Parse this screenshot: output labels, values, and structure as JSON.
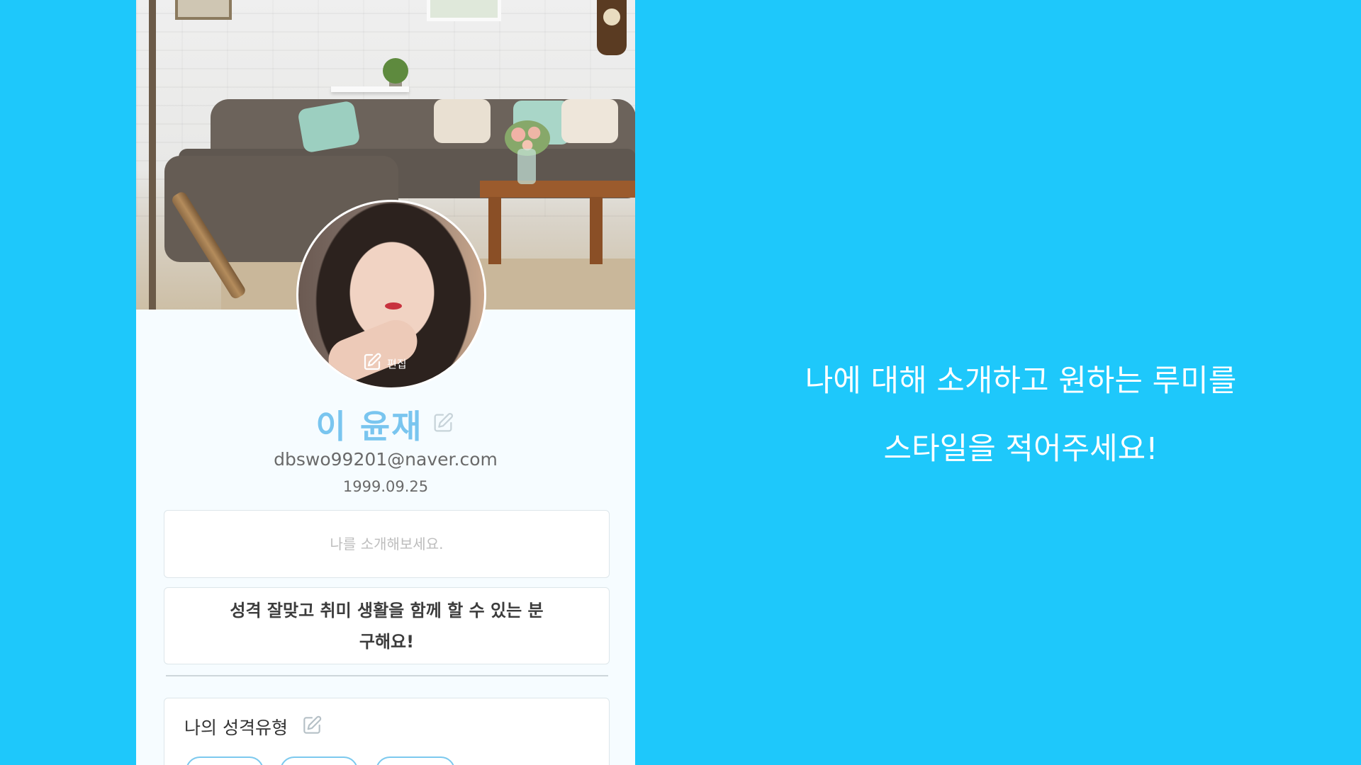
{
  "profile": {
    "name": "이 윤재",
    "email": "dbswo99201@naver.com",
    "birthdate": "1999.09.25",
    "avatar_edit_label": "편집",
    "intro_placeholder": "나를 소개해보세요.",
    "wish_text_line1": "성격 잘맞고 취미 생활을 함께 할 수 있는 분",
    "wish_text_line2": "구해요!",
    "personality_title": "나의 성격유형"
  },
  "caption": {
    "line1": "나에 대해 소개하고 원하는 루미를",
    "line2": "스타일을 적어주세요!"
  },
  "icons": {
    "edit": "pencil-square-icon"
  },
  "colors": {
    "background": "#1ec8fb",
    "name": "#79c5ef",
    "panel": "#f6fcff"
  }
}
